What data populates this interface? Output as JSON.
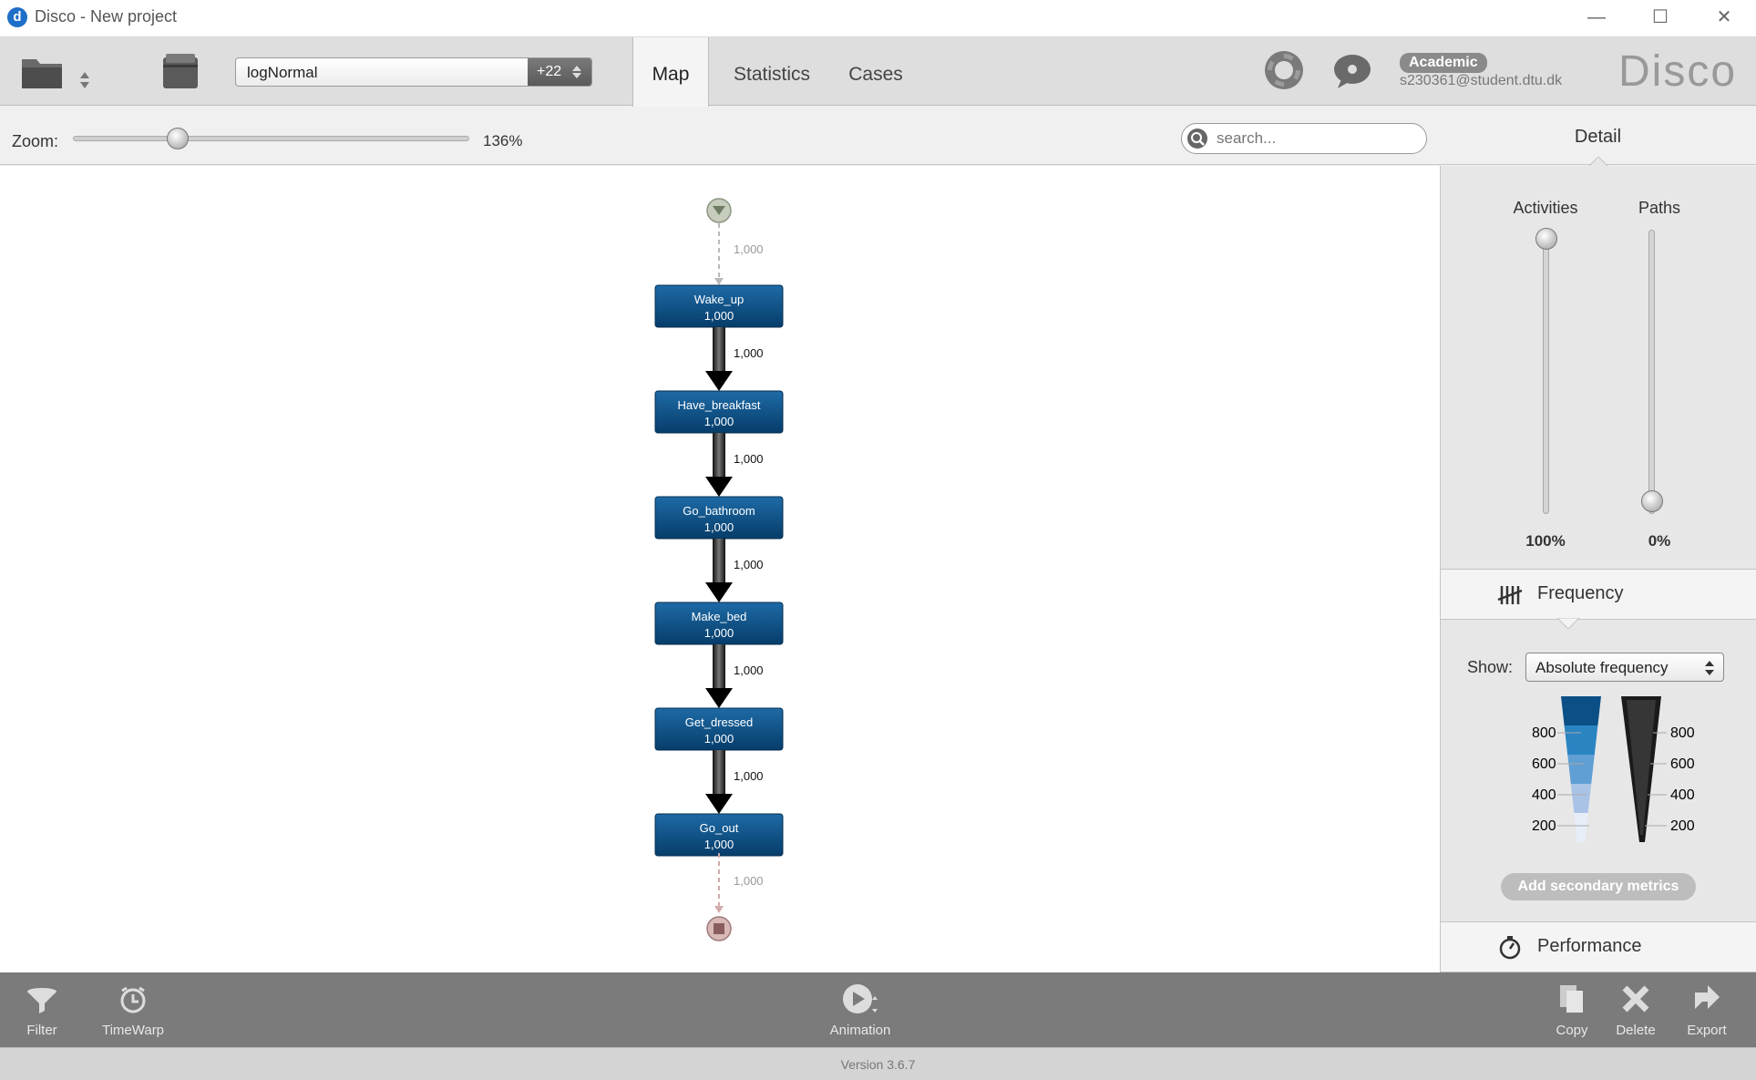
{
  "window": {
    "title": "Disco - New project",
    "logo_letter": "d",
    "controls": {
      "minimize": "—",
      "maximize": "☐",
      "close": "✕"
    }
  },
  "toolbar": {
    "dataset_name": "logNormal",
    "dataset_count": "+22",
    "tabs": [
      {
        "label": "Map",
        "active": true
      },
      {
        "label": "Statistics",
        "active": false
      },
      {
        "label": "Cases",
        "active": false
      }
    ],
    "license": "Academic",
    "user_email": "s230361@student.dtu.dk",
    "brand": "Disco"
  },
  "zoom": {
    "label": "Zoom:",
    "value_text": "136%",
    "value_fraction": 0.28
  },
  "search": {
    "placeholder": "search..."
  },
  "detail": {
    "title": "Detail",
    "activities_label": "Activities",
    "paths_label": "Paths",
    "activities_value": "100%",
    "paths_value": "0%",
    "activities_level": 1.0,
    "paths_level": 0.0
  },
  "frequency": {
    "title": "Frequency",
    "show_label": "Show:",
    "show_value": "Absolute frequency",
    "scale_ticks": [
      "800",
      "600",
      "400",
      "200"
    ],
    "activity_colors": [
      "#0b4f86",
      "#2a84c2",
      "#5f9fd3",
      "#a9c3e6",
      "#e8eef8"
    ],
    "add_metrics_label": "Add secondary metrics"
  },
  "performance": {
    "title": "Performance"
  },
  "process_map": {
    "start_edge_label": "1,000",
    "end_edge_label": "1,000",
    "activities": [
      {
        "name": "Wake_up",
        "count": "1,000"
      },
      {
        "name": "Have_breakfast",
        "count": "1,000"
      },
      {
        "name": "Go_bathroom",
        "count": "1,000"
      },
      {
        "name": "Make_bed",
        "count": "1,000"
      },
      {
        "name": "Get_dressed",
        "count": "1,000"
      },
      {
        "name": "Go_out",
        "count": "1,000"
      }
    ],
    "edge_labels": [
      "1,000",
      "1,000",
      "1,000",
      "1,000",
      "1,000"
    ],
    "node_color": "#0b4f86"
  },
  "bottom": {
    "filter": "Filter",
    "timewarp": "TimeWarp",
    "animation": "Animation",
    "copy": "Copy",
    "delete": "Delete",
    "export": "Export"
  },
  "status": {
    "version": "Version 3.6.7"
  }
}
